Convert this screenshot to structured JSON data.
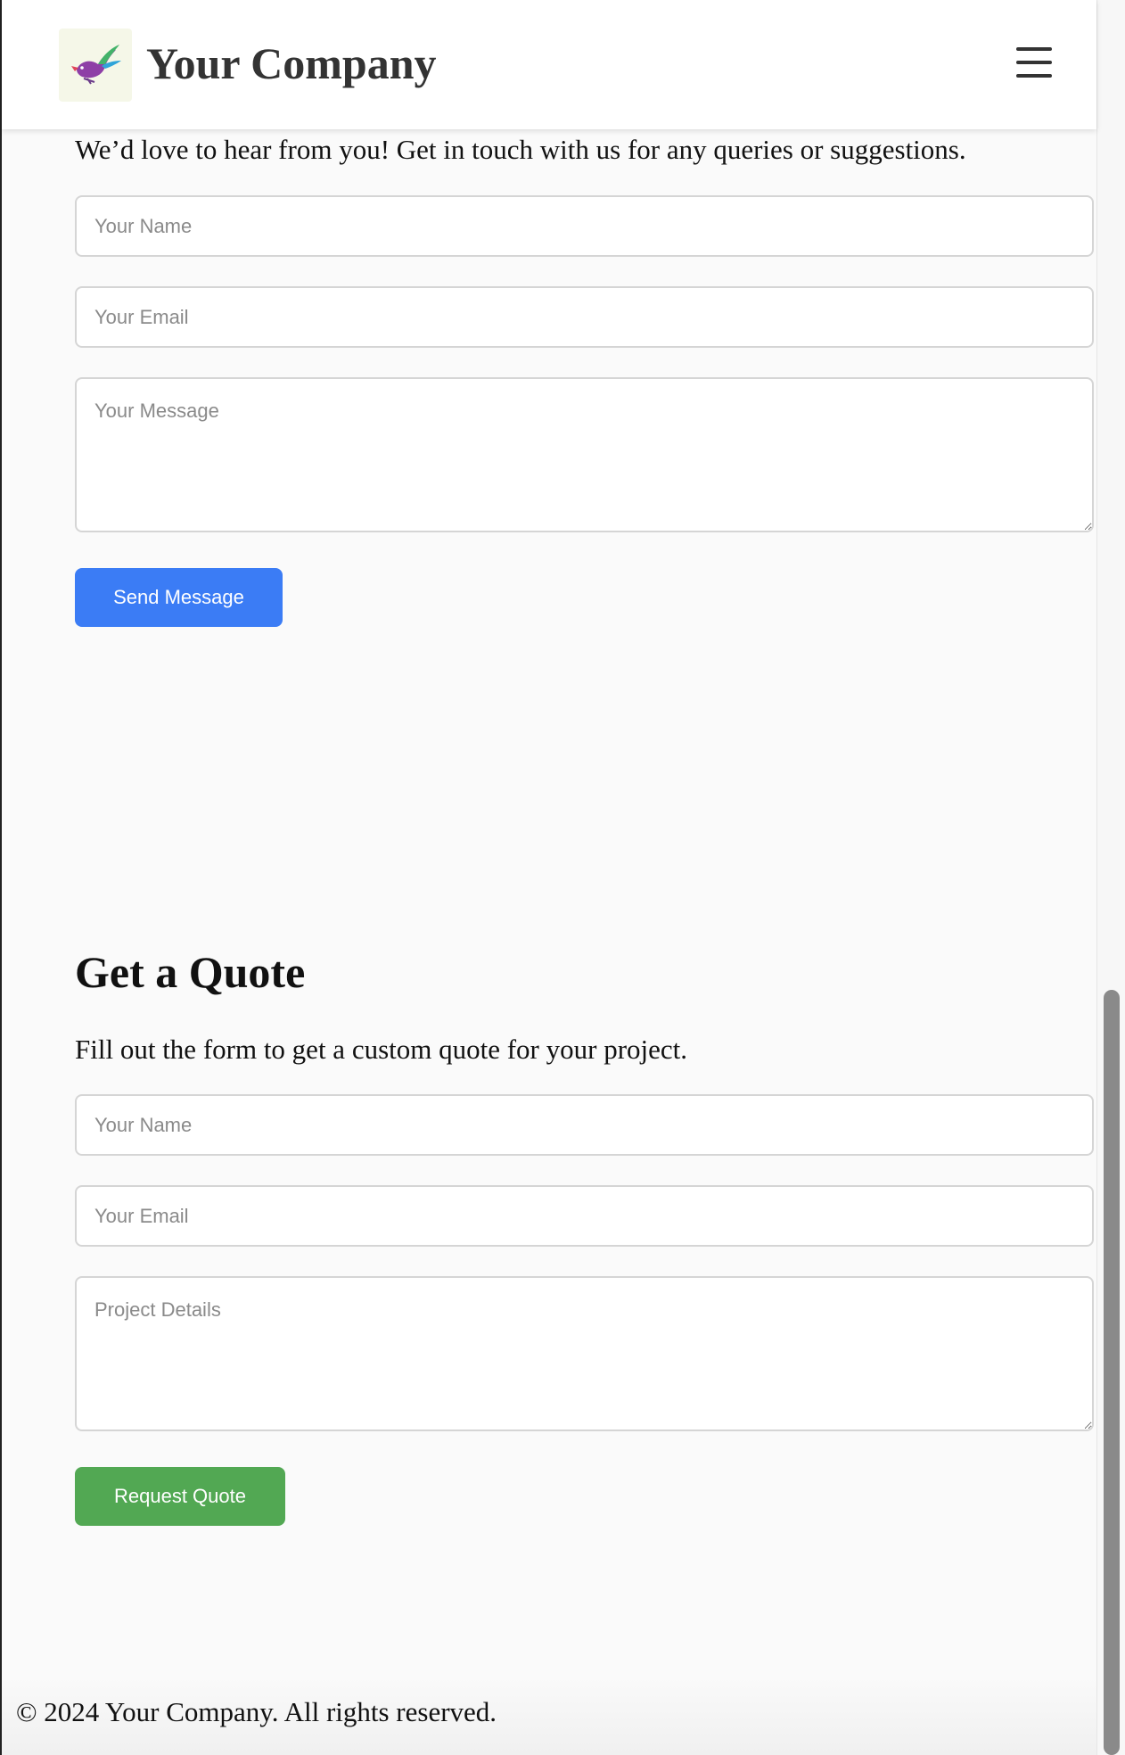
{
  "header": {
    "brand": "Your Company",
    "logo_icon": "bird-logo-icon",
    "menu_icon": "hamburger-menu-icon"
  },
  "contact": {
    "intro": "We’d love to hear from you! Get in touch with us for any queries or suggestions.",
    "name_placeholder": "Your Name",
    "email_placeholder": "Your Email",
    "message_placeholder": "Your Message",
    "submit_label": "Send Message"
  },
  "quote": {
    "title": "Get a Quote",
    "subtitle": "Fill out the form to get a custom quote for your project.",
    "name_placeholder": "Your Name",
    "email_placeholder": "Your Email",
    "details_placeholder": "Project Details",
    "submit_label": "Request Quote"
  },
  "footer": {
    "copyright": "© 2024 Your Company. All rights reserved."
  },
  "colors": {
    "primary_button": "#3b7cf5",
    "quote_button": "#52a853"
  }
}
